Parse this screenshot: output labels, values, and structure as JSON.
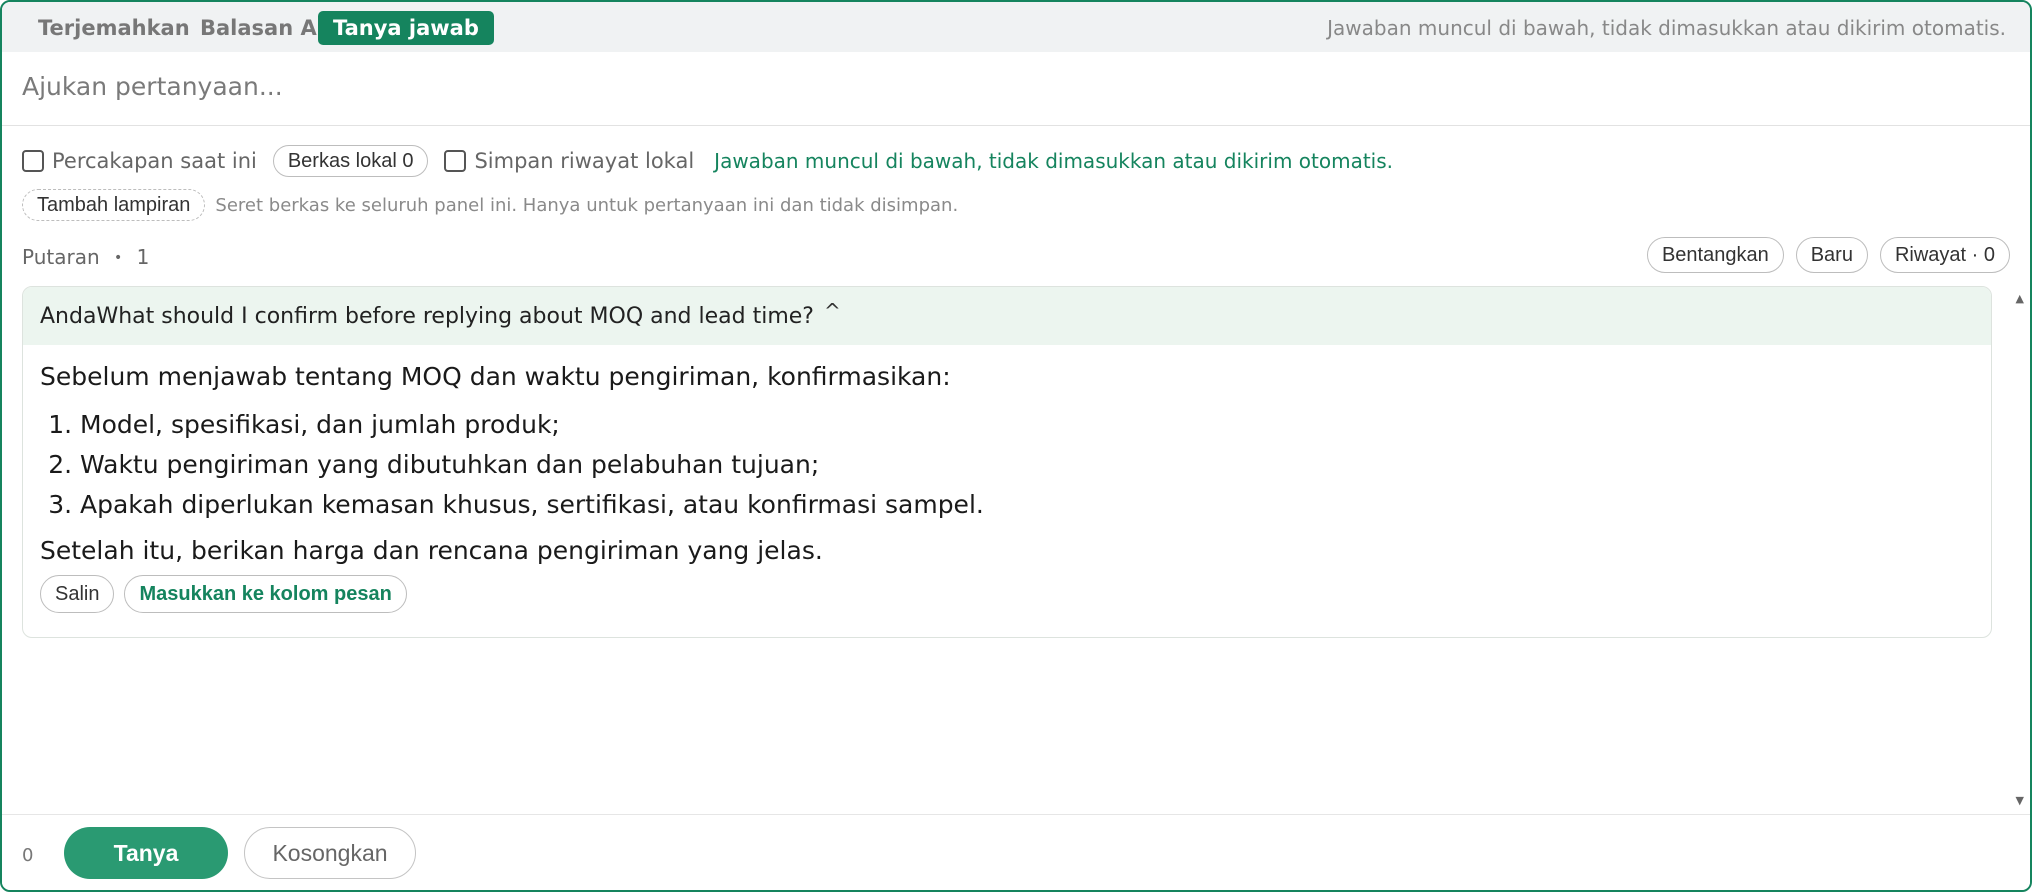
{
  "tabs": [
    {
      "label": "Terjemahkan",
      "active": false
    },
    {
      "label": "Balasan AI",
      "active": false
    },
    {
      "label": "Tanya jawab",
      "active": true
    }
  ],
  "tab_hint": "Jawaban muncul di bawah, tidak dimasukkan atau dikirim otomatis.",
  "question": {
    "placeholder": "Ajukan pertanyaan...",
    "value": ""
  },
  "options": {
    "current_chat_label": "Percakapan saat ini",
    "current_chat_checked": false,
    "local_files_label": "Berkas lokal 0",
    "save_history_label": "Simpan riwayat lokal",
    "save_history_checked": false,
    "status_text": "Jawaban muncul di bawah, tidak dimasukkan atau dikirim otomatis."
  },
  "attachment": {
    "button_label": "Tambah lampiran",
    "hint": "Seret berkas ke seluruh panel ini. Hanya untuk pertanyaan ini dan tidak disimpan."
  },
  "turns": {
    "label": "Putaran",
    "separator": "•",
    "count": "1"
  },
  "top_actions": {
    "expand": "Bentangkan",
    "new": "Baru",
    "history": "Riwayat · 0"
  },
  "conversation": {
    "speaker": "Anda",
    "question": "What should I confirm before replying about MOQ and lead time?",
    "collapse_glyph": "^",
    "answer_intro": "Sebelum menjawab tentang MOQ dan waktu pengiriman, konfirmasikan:",
    "answer_items": [
      "Model, spesifikasi, dan jumlah produk;",
      "Waktu pengiriman yang dibutuhkan dan pelabuhan tujuan;",
      "Apakah diperlukan kemasan khusus, sertifikasi, atau konfirmasi sampel."
    ],
    "answer_outro": "Setelah itu, berikan harga dan rencana pengiriman yang jelas.",
    "copy_label": "Salin",
    "insert_label": "Masukkan ke kolom pesan"
  },
  "footer": {
    "char_count": "0",
    "ask_label": "Tanya",
    "clear_label": "Kosongkan"
  },
  "colors": {
    "accent": "#15845e",
    "accent_button": "#2a9a72",
    "card_header_bg": "#ecf5ef",
    "tabbar_bg": "#f0f2f3"
  }
}
